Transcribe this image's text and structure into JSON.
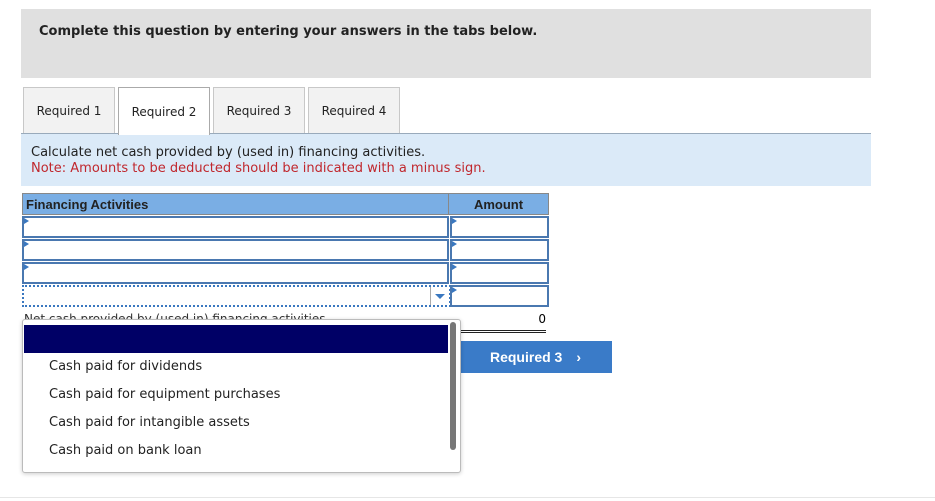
{
  "header": {
    "instruction": "Complete this question by entering your answers in the tabs below."
  },
  "tabs": [
    {
      "label": "Required 1"
    },
    {
      "label": "Required 2",
      "active": true
    },
    {
      "label": "Required 3"
    },
    {
      "label": "Required 4"
    }
  ],
  "instructions": {
    "text": "Calculate net cash provided by (used in) financing activities.",
    "note": "Note: Amounts to be deducted should be indicated with a minus sign."
  },
  "table": {
    "headers": [
      "Financing Activities",
      "Amount"
    ],
    "rows": [
      {
        "activity": "",
        "amount": ""
      },
      {
        "activity": "",
        "amount": ""
      },
      {
        "activity": "",
        "amount": ""
      },
      {
        "activity": "",
        "amount": ""
      }
    ],
    "total_label": "Net cash provided by (used in) financing activities",
    "total_value": "0"
  },
  "dropdown": {
    "selected": "",
    "options": [
      "Cash paid for dividends",
      "Cash paid for equipment purchases",
      "Cash paid for intangible assets",
      "Cash paid on bank loan"
    ]
  },
  "nav": {
    "next_label": "Required 3",
    "next_icon": "chevron-right-icon"
  },
  "colors": {
    "header_blue": "#7aaee4",
    "button": "#3a7bc8",
    "highlight": "#000066",
    "note": "#c0272d"
  }
}
